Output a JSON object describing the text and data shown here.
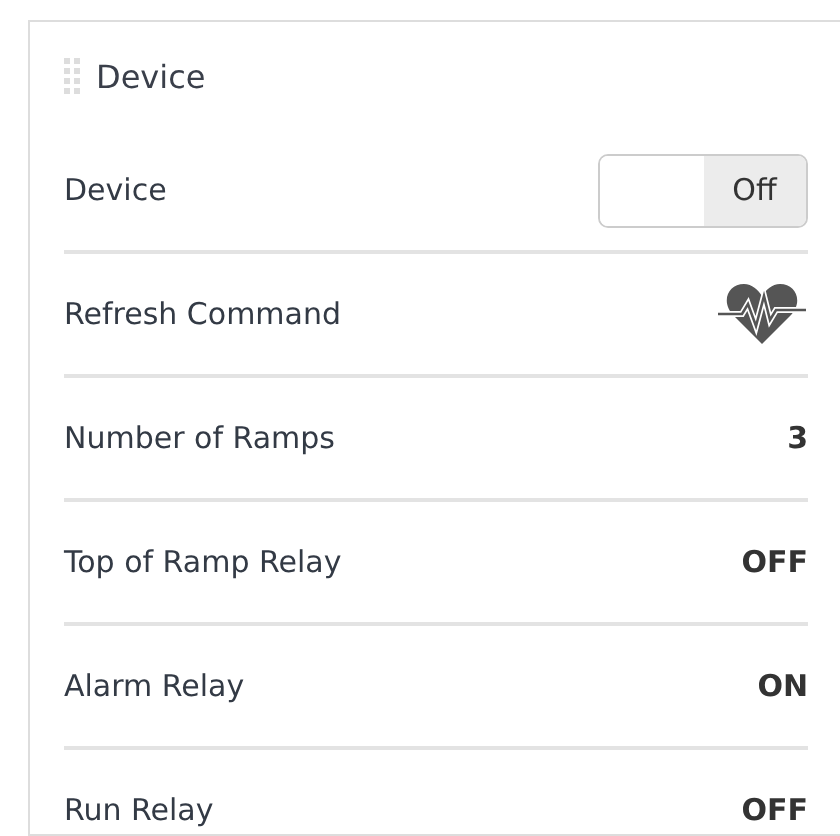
{
  "panel": {
    "title": "Device"
  },
  "rows": [
    {
      "label": "Device",
      "kind": "toggle",
      "on": false,
      "value": "Off"
    },
    {
      "label": "Refresh Command",
      "kind": "icon"
    },
    {
      "label": "Number of Ramps",
      "kind": "text",
      "value": "3"
    },
    {
      "label": "Top of Ramp Relay",
      "kind": "text",
      "value": "OFF"
    },
    {
      "label": "Alarm Relay",
      "kind": "text",
      "value": "ON"
    },
    {
      "label": "Run Relay",
      "kind": "text",
      "value": "OFF"
    }
  ]
}
